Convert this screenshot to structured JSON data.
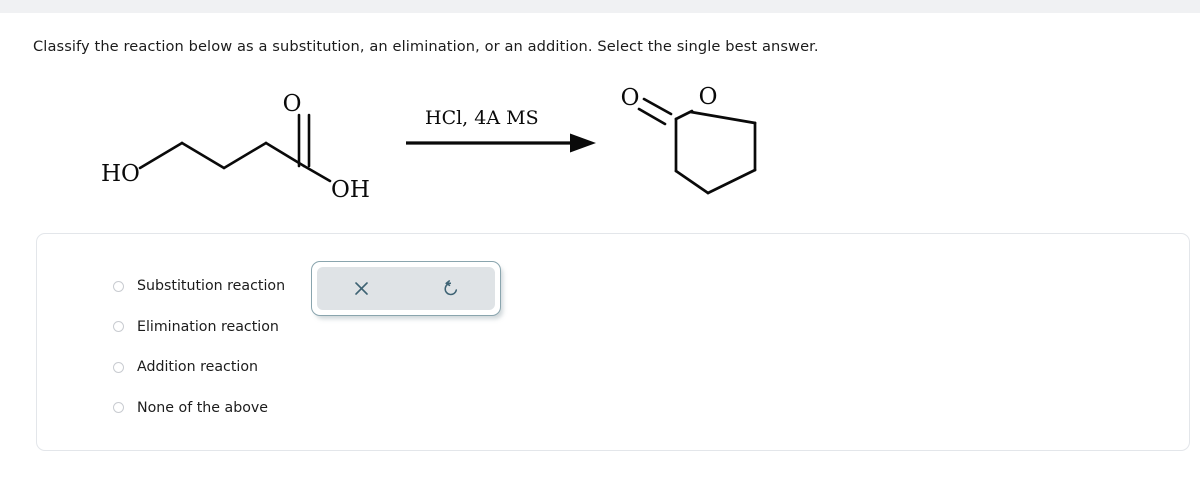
{
  "page": {
    "question": "Classify the reaction below as a substitution, an elimination, or an addition. Select the single best answer."
  },
  "reaction": {
    "reactant": {
      "name": "5-hydroxypentanoic-acid",
      "left_label": "HO",
      "right_label": "OH",
      "carbonyl_label": "O"
    },
    "conditions": {
      "text": "HCl, 4A MS"
    },
    "product": {
      "name": "delta-valerolactone",
      "carbonyl_label": "O",
      "ring_oxygen_label": "O"
    }
  },
  "answers": {
    "options": [
      {
        "label": "Substitution reaction",
        "selected": false
      },
      {
        "label": "Elimination reaction",
        "selected": false
      },
      {
        "label": "Addition reaction",
        "selected": false
      },
      {
        "label": "None of the above",
        "selected": false
      }
    ]
  },
  "tools": {
    "buttons": [
      {
        "name": "clear-icon",
        "glyph": "×"
      },
      {
        "name": "undo-icon",
        "glyph": "↺"
      }
    ],
    "icon_color": "#3e6374",
    "panel_border_color": "#8aa5ae",
    "panel_fill_color": "#dfe3e6"
  }
}
